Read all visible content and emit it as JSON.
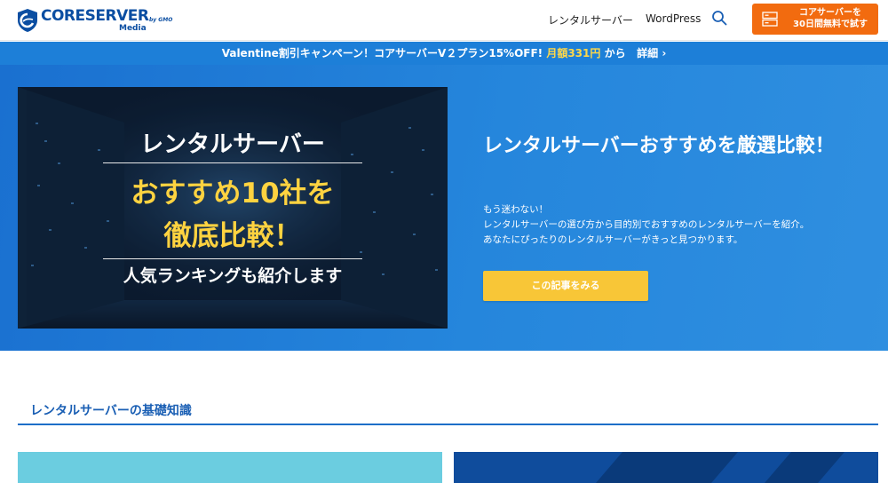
{
  "header": {
    "logo_text": "CORESERVER",
    "logo_gmo": "by GMO",
    "logo_sub": "Media",
    "nav": [
      "レンタルサーバー",
      "WordPress"
    ],
    "search_icon": "search-icon",
    "trial_line1": "コアサーバーを",
    "trial_line2": "30日間無料で試す",
    "trial_icon": "server-icon"
  },
  "promo": {
    "text": "Valentine割引キャンペーン！コアサーバーV２プラン15%OFF!",
    "price": "月額331円",
    "suffix": "から",
    "link": "詳細 ›"
  },
  "hero": {
    "banner": {
      "line1": "レンタルサーバー",
      "line2": "おすすめ10社を",
      "line3": "徹底比較！",
      "line4": "人気ランキングも紹介します"
    },
    "heading": "レンタルサーバーおすすめを厳選比較！",
    "desc": [
      "もう迷わない！",
      "レンタルサーバーの選び方から目的別でおすすめのレンタルサーバーを紹介。",
      "あなたにぴったりのレンタルサーバーがきっと見つかります。"
    ],
    "cta": "この記事をみる"
  },
  "section": {
    "title": "レンタルサーバーの基礎知識"
  },
  "colors": {
    "brand": "#0b4ea2",
    "promo": "#1d7fd8",
    "trial": "#f26b0f",
    "cta": "#f8c637",
    "highlight": "#ffd340"
  }
}
